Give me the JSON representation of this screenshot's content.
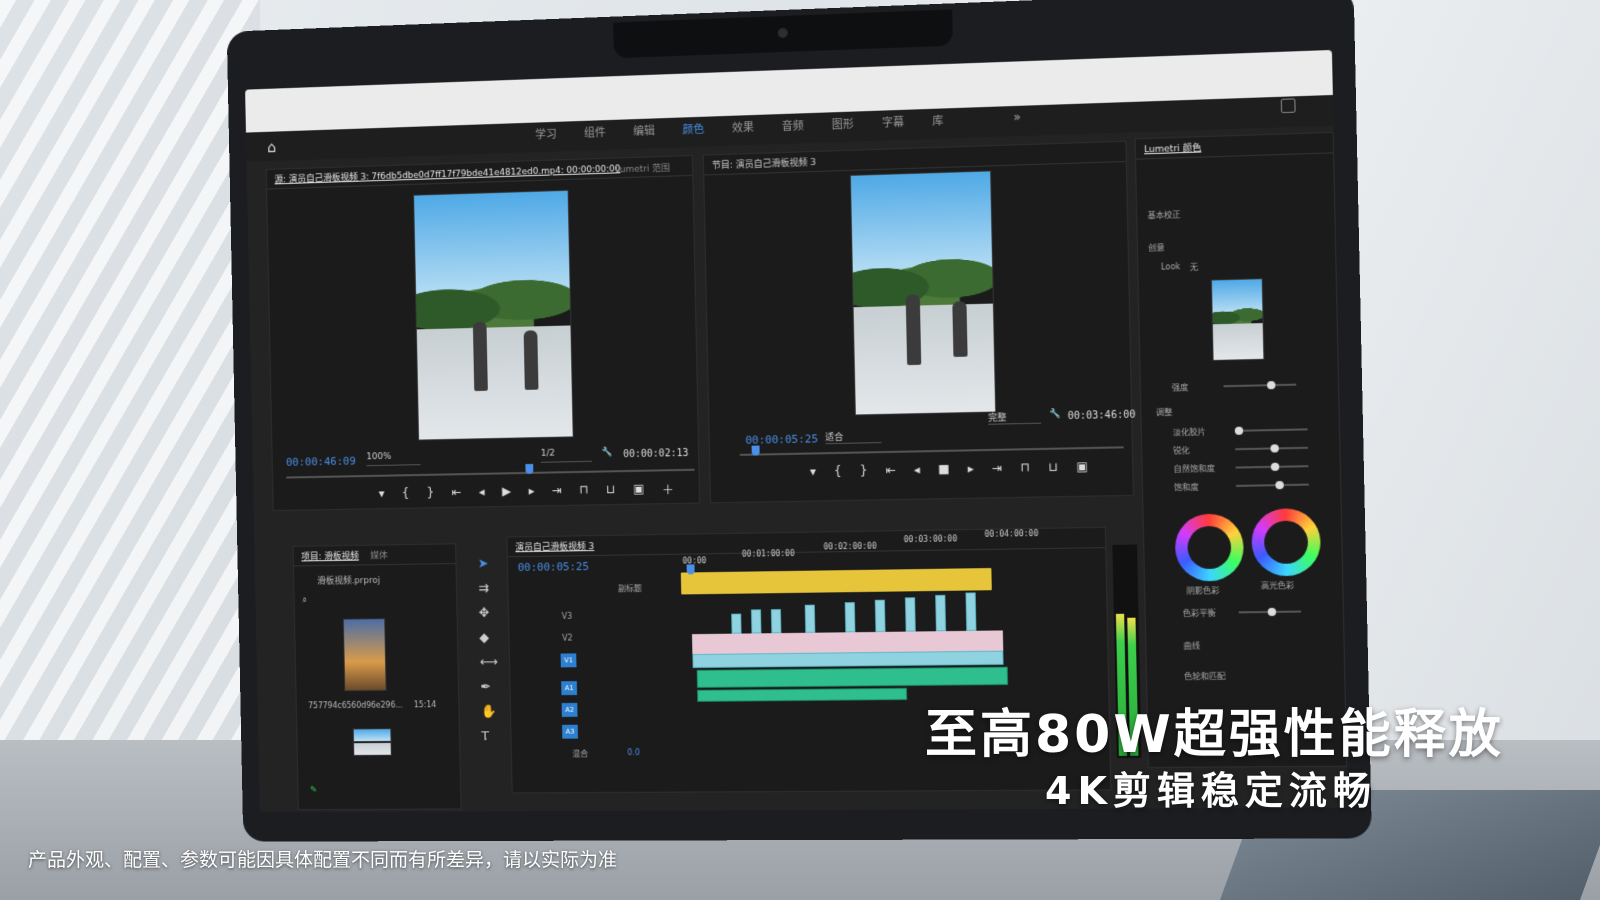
{
  "workspace_tabs": [
    "学习",
    "组件",
    "编辑",
    "颜色",
    "效果",
    "音频",
    "图形",
    "字幕",
    "库"
  ],
  "active_workspace": "颜色",
  "source_monitor": {
    "title": "源: 演员自己滑板视频 3: 7f6db5dbe0d7ff17f79bde41e4812ed0.mp4: 00:00:00:00",
    "scope_tab": "Lumetri 范围",
    "timecode": "00:00:46:09",
    "zoom": "100%",
    "resolution": "1/2",
    "duration": "00:00:02:13"
  },
  "program_monitor": {
    "title": "节目: 演员自己滑板视频 3",
    "timecode": "00:00:05:25",
    "fit": "适合",
    "quality": "完整",
    "duration": "00:03:46:00"
  },
  "project_panel": {
    "tab": "项目: 滑板视频",
    "tab2": "媒体",
    "file": "滑板视频.prproj",
    "clip_name": "757794c6560d96e296...",
    "clip_duration": "15:14"
  },
  "timeline": {
    "title": "演员自己滑板视频 3",
    "timecode": "00:00:05:25",
    "ruler": [
      "00:00",
      "00:01:00:00",
      "00:02:00:00",
      "00:03:00:00",
      "00:04:00:00"
    ],
    "subtitle_track": "副标题",
    "video_tracks": [
      "V3",
      "V2",
      "V1"
    ],
    "audio_tracks": [
      "A1",
      "A2",
      "A3"
    ],
    "mix_label": "混合",
    "mix_value": "0.0"
  },
  "lumetri": {
    "title": "Lumetri 颜色",
    "section_basic": "基本校正",
    "section_creative": "创意",
    "look": "Look",
    "look_value": "无",
    "intensity": "强度",
    "adjust": "调整",
    "rows": [
      "淡化胶片",
      "锐化",
      "自然饱和度",
      "饱和度"
    ],
    "wheel_shadow": "阴影色彩",
    "wheel_highlight": "高光色彩",
    "tint_balance": "色彩平衡",
    "curves": "曲线",
    "color_match": "色轮和匹配"
  },
  "headline": "至高80W超强性能释放",
  "subline": "4K剪辑稳定流畅",
  "disclaimer": "产品外观、配置、参数可能因具体配置不同而有所差异，请以实际为准",
  "colors": {
    "accent": "#4a8fe8",
    "clip_video": "#8fd3e0",
    "clip_audio": "#2fbf8f",
    "work_area": "#e6c53a"
  }
}
